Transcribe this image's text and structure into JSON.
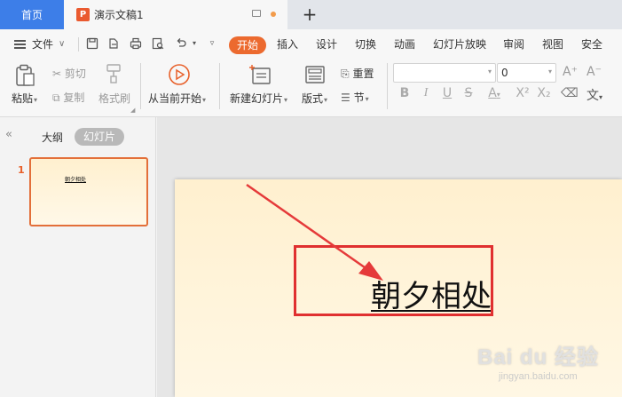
{
  "tabs": {
    "home_label": "首页",
    "doc_badge": "P",
    "doc_label": "演示文稿1",
    "add_label": "+"
  },
  "menu": {
    "file_label": "文件",
    "chevron": "∨",
    "start_label": "开始",
    "items": [
      "插入",
      "设计",
      "切换",
      "动画",
      "幻灯片放映",
      "审阅",
      "视图",
      "安全"
    ]
  },
  "ribbon": {
    "paste": "粘贴",
    "cut": "剪切",
    "copy": "复制",
    "format_painter": "格式刷",
    "from_current": "从当前开始",
    "new_slide": "新建幻灯片",
    "layout": "版式",
    "reset": "重置",
    "section": "节",
    "font_size_value": "0"
  },
  "panel": {
    "outline_tab": "大纲",
    "slides_tab": "幻灯片",
    "slide_number": "1",
    "thumb_text": "朝夕相处"
  },
  "slide": {
    "title": "朝夕相处"
  },
  "watermark": {
    "brand": "Bai du 经验",
    "url": "jingyan.baidu.com"
  },
  "colors": {
    "accent": "#ec6a2f",
    "home_tab": "#3d7ee8",
    "annotation": "#e03030",
    "slide_bg": "#fff0cf"
  }
}
